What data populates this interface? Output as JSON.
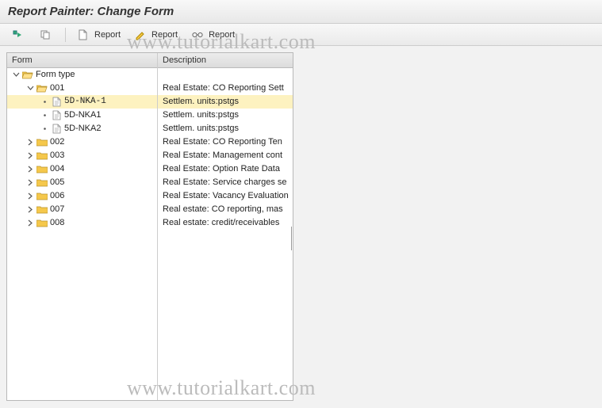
{
  "title": "Report Painter: Change Form",
  "watermark": "www.tutorialkart.com",
  "toolbar": {
    "btn_execute": "",
    "btn_copy": "",
    "btn_report_new": "Report",
    "btn_report_edit": "Report",
    "btn_report_display": "Report"
  },
  "columns": {
    "form": "Form",
    "description": "Description"
  },
  "tree": [
    {
      "level": 0,
      "expander": "down",
      "icon": "folder-open",
      "label": "Form type",
      "desc": "",
      "selected": false,
      "mono": false
    },
    {
      "level": 1,
      "expander": "down",
      "icon": "folder-open",
      "label": "001",
      "desc": "Real Estate: CO Reporting Sett",
      "selected": false,
      "mono": false
    },
    {
      "level": 2,
      "expander": "dot",
      "icon": "document",
      "label": "5D-NKA-1",
      "desc": "Settlem. units:pstgs",
      "selected": true,
      "mono": true
    },
    {
      "level": 2,
      "expander": "dot",
      "icon": "document",
      "label": "5D-NKA1",
      "desc": "Settlem. units:pstgs",
      "selected": false,
      "mono": false
    },
    {
      "level": 2,
      "expander": "dot",
      "icon": "document",
      "label": "5D-NKA2",
      "desc": "Settlem. units:pstgs",
      "selected": false,
      "mono": false
    },
    {
      "level": 1,
      "expander": "right",
      "icon": "folder",
      "label": "002",
      "desc": "Real Estate: CO Reporting Ten",
      "selected": false,
      "mono": false
    },
    {
      "level": 1,
      "expander": "right",
      "icon": "folder",
      "label": "003",
      "desc": "Real Estate: Management cont",
      "selected": false,
      "mono": false
    },
    {
      "level": 1,
      "expander": "right",
      "icon": "folder",
      "label": "004",
      "desc": "Real Estate: Option Rate Data",
      "selected": false,
      "mono": false
    },
    {
      "level": 1,
      "expander": "right",
      "icon": "folder",
      "label": "005",
      "desc": "Real Estate: Service charges se",
      "selected": false,
      "mono": false
    },
    {
      "level": 1,
      "expander": "right",
      "icon": "folder",
      "label": "006",
      "desc": "Real Estate: Vacancy Evaluation",
      "selected": false,
      "mono": false
    },
    {
      "level": 1,
      "expander": "right",
      "icon": "folder",
      "label": "007",
      "desc": "Real estate: CO reporting, mas",
      "selected": false,
      "mono": false
    },
    {
      "level": 1,
      "expander": "right",
      "icon": "folder",
      "label": "008",
      "desc": "Real estate: credit/receivables",
      "selected": false,
      "mono": false
    }
  ]
}
